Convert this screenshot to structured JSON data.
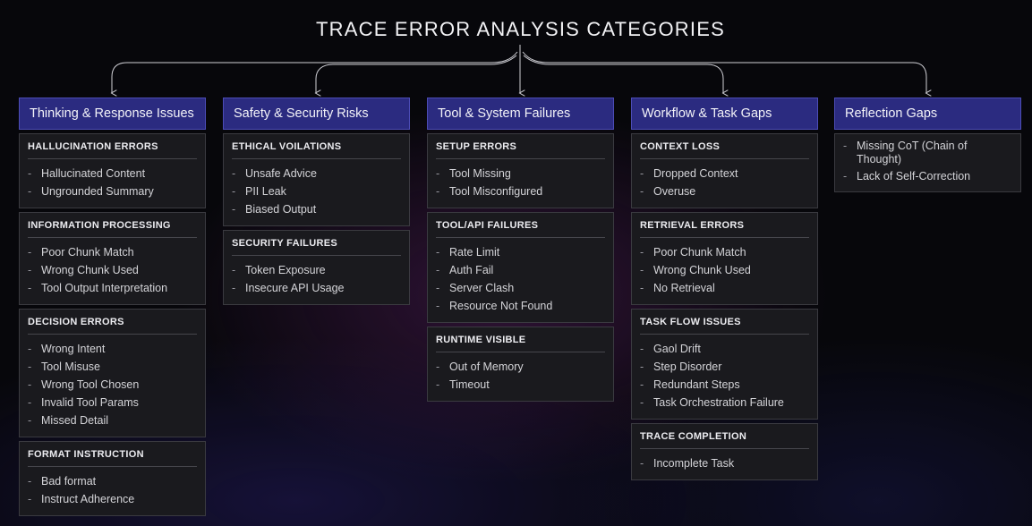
{
  "title": "TRACE ERROR ANALYSIS CATEGORIES",
  "colors": {
    "header_fill": "#2b2b80",
    "header_border": "#4c4cb6",
    "card_fill": "#1a1a1e",
    "connector": "#d0d0d6"
  },
  "columns": [
    {
      "header": "Thinking & Response Issues",
      "groups": [
        {
          "title": "HALLUCINATION ERRORS",
          "items": [
            "Hallucinated Content",
            "Ungrounded Summary"
          ]
        },
        {
          "title": "INFORMATION PROCESSING",
          "items": [
            "Poor Chunk Match",
            "Wrong Chunk Used",
            "Tool Output Interpretation"
          ]
        },
        {
          "title": "DECISION ERRORS",
          "items": [
            "Wrong Intent",
            "Tool Misuse",
            "Wrong Tool Chosen",
            "Invalid Tool Params",
            "Missed Detail"
          ]
        },
        {
          "title": "FORMAT INSTRUCTION",
          "items": [
            "Bad format",
            "Instruct Adherence"
          ]
        }
      ]
    },
    {
      "header": "Safety & Security Risks",
      "groups": [
        {
          "title": "ETHICAL VOILATIONS",
          "items": [
            "Unsafe Advice",
            "PII Leak",
            "Biased Output"
          ]
        },
        {
          "title": "SECURITY FAILURES",
          "items": [
            "Token Exposure",
            "Insecure API Usage"
          ]
        }
      ]
    },
    {
      "header": "Tool & System Failures",
      "groups": [
        {
          "title": "SETUP ERRORS",
          "items": [
            "Tool Missing",
            "Tool Misconfigured"
          ]
        },
        {
          "title": "TOOL/API FAILURES",
          "items": [
            "Rate Limit",
            "Auth Fail",
            "Server Clash",
            "Resource Not Found"
          ]
        },
        {
          "title": "RUNTIME VISIBLE",
          "items": [
            "Out of Memory",
            "Timeout"
          ]
        }
      ]
    },
    {
      "header": "Workflow & Task Gaps",
      "groups": [
        {
          "title": "CONTEXT LOSS",
          "items": [
            "Dropped Context",
            "Overuse"
          ]
        },
        {
          "title": "RETRIEVAL ERRORS",
          "items": [
            "Poor Chunk Match",
            "Wrong Chunk Used",
            "No Retrieval"
          ]
        },
        {
          "title": "TASK FLOW ISSUES",
          "items": [
            "Gaol Drift",
            "Step Disorder",
            "Redundant Steps",
            "Task Orchestration Failure"
          ]
        },
        {
          "title": "TRACE COMPLETION",
          "items": [
            "Incomplete Task"
          ]
        }
      ]
    },
    {
      "header": "Reflection Gaps",
      "groups": [
        {
          "title": "",
          "items": [
            "Missing CoT (Chain of Thought)",
            "Lack of Self-Correction"
          ]
        }
      ]
    }
  ]
}
